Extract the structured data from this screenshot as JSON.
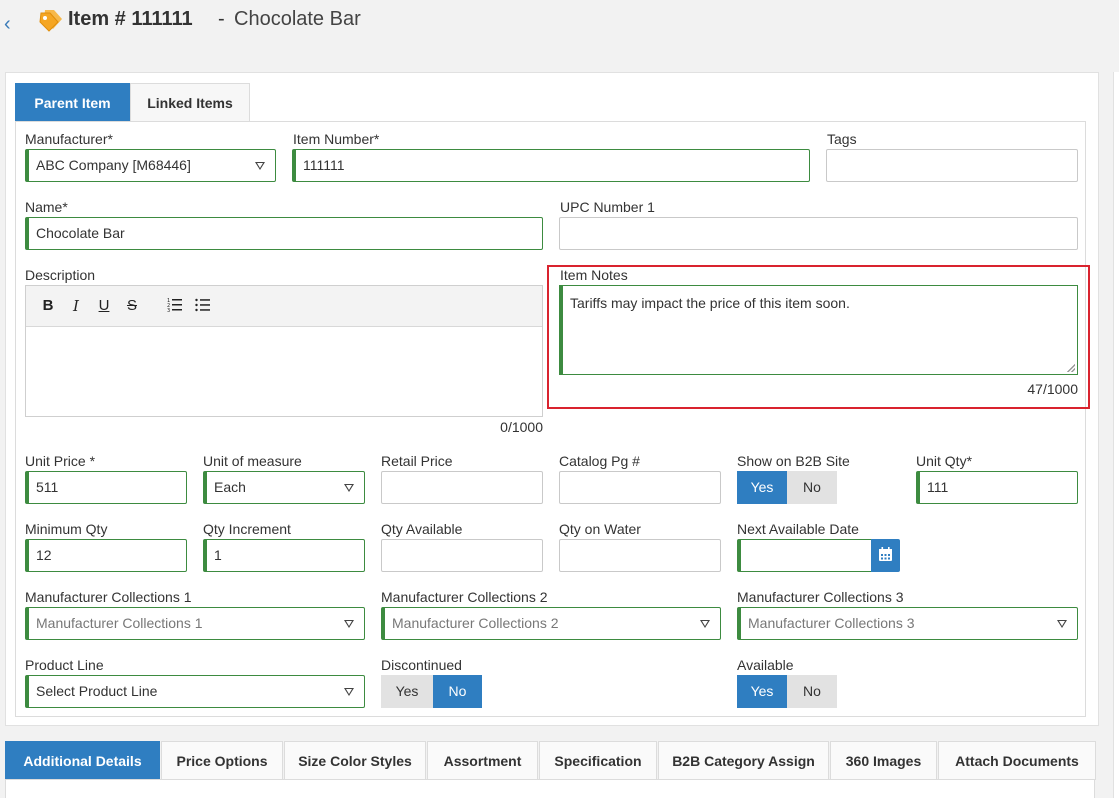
{
  "header": {
    "item_number": "Item # 111111",
    "separator": "-",
    "item_name": "Chocolate Bar",
    "back_icon": "chevron-left-icon",
    "tag_icon": "tags-icon",
    "accent_color": "#f5a623"
  },
  "tabs": [
    {
      "label": "Parent Item",
      "active": true
    },
    {
      "label": "Linked Items",
      "active": false
    }
  ],
  "form": {
    "manufacturer": {
      "label": "Manufacturer*",
      "value": "ABC Company [M68446]"
    },
    "item_number": {
      "label": "Item Number*",
      "value": "111111"
    },
    "tags": {
      "label": "Tags",
      "value": ""
    },
    "name": {
      "label": "Name*",
      "value": "Chocolate Bar"
    },
    "upc": {
      "label": "UPC Number 1",
      "value": ""
    },
    "description": {
      "label": "Description",
      "value": "",
      "counter": "0/1000"
    },
    "item_notes": {
      "label": "Item Notes",
      "value": "Tariffs may impact the price of this item soon.",
      "counter": "47/1000"
    },
    "unit_price": {
      "label": "Unit Price *",
      "value": "511"
    },
    "unit_of_measure": {
      "label": "Unit of measure",
      "value": "Each"
    },
    "retail_price": {
      "label": "Retail Price",
      "value": ""
    },
    "catalog_pg": {
      "label": "Catalog Pg #",
      "value": ""
    },
    "show_b2b": {
      "label": "Show on B2B Site",
      "yes": "Yes",
      "no": "No",
      "selected": "Yes"
    },
    "unit_qty": {
      "label": "Unit Qty*",
      "value": "111"
    },
    "minimum_qty": {
      "label": "Minimum Qty",
      "value": "12"
    },
    "qty_increment": {
      "label": "Qty Increment",
      "value": "1"
    },
    "qty_available": {
      "label": "Qty Available",
      "value": ""
    },
    "qty_on_water": {
      "label": "Qty on Water",
      "value": ""
    },
    "next_available_date": {
      "label": "Next Available Date",
      "value": ""
    },
    "mfr_collections_1": {
      "label": "Manufacturer Collections 1",
      "placeholder": "Manufacturer Collections 1"
    },
    "mfr_collections_2": {
      "label": "Manufacturer Collections 2",
      "placeholder": "Manufacturer Collections 2"
    },
    "mfr_collections_3": {
      "label": "Manufacturer Collections 3",
      "placeholder": "Manufacturer Collections 3"
    },
    "product_line": {
      "label": "Product Line",
      "value": "Select Product Line"
    },
    "discontinued": {
      "label": "Discontinued",
      "yes": "Yes",
      "no": "No",
      "selected": "No"
    },
    "available": {
      "label": "Available",
      "yes": "Yes",
      "no": "No",
      "selected": "Yes"
    }
  },
  "editor_toolbar": [
    "bold-icon",
    "italic-icon",
    "underline-icon",
    "strikethrough-icon",
    "ordered-list-icon",
    "unordered-list-icon"
  ],
  "bottom_tabs": [
    {
      "label": "Additional Details",
      "active": true
    },
    {
      "label": "Price Options",
      "active": false
    },
    {
      "label": "Size Color Styles",
      "active": false
    },
    {
      "label": "Assortment",
      "active": false
    },
    {
      "label": "Specification",
      "active": false
    },
    {
      "label": "B2B Category Assign",
      "active": false
    },
    {
      "label": "360 Images",
      "active": false
    },
    {
      "label": "Attach Documents",
      "active": false
    }
  ],
  "colors": {
    "primary": "#2f7ec1",
    "valid_border": "#3d8b40",
    "highlight": "#d9232e"
  }
}
